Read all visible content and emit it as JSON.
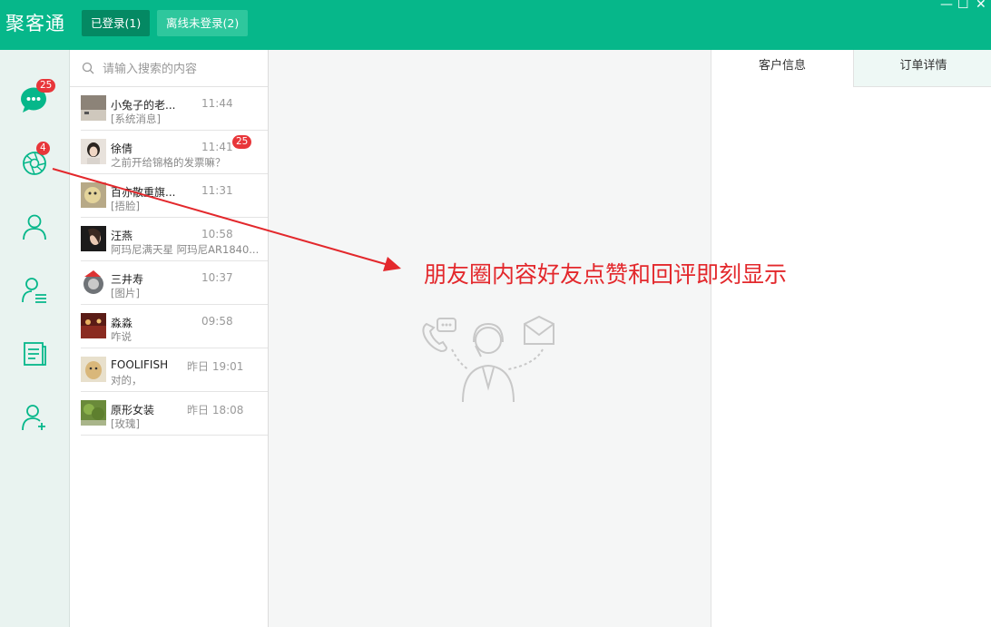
{
  "app": {
    "title": "聚客通",
    "tab_logged_in": "已登录(1)",
    "tab_offline": "离线未登录(2)",
    "window_controls": [
      "—",
      "☐",
      "✕"
    ]
  },
  "nav": {
    "chat_badge": "25",
    "moments_badge": "4"
  },
  "search": {
    "placeholder": "请输入搜索的内容"
  },
  "chats": [
    {
      "name": "小兔子的老...",
      "time": "11:44",
      "msg": "[系统消息]"
    },
    {
      "name": "徐倩",
      "time": "11:41",
      "msg": "之前开给锦格的发票嘛？",
      "badge": "25"
    },
    {
      "name": "百亦散重旗...",
      "time": "11:31",
      "msg": "[捂脸]"
    },
    {
      "name": "汪燕",
      "time": "10:58",
      "msg": "阿玛尼满天星 阿玛尼AR1840..."
    },
    {
      "name": "三井寿",
      "time": "10:37",
      "msg": "[图片]"
    },
    {
      "name": "淼淼",
      "time": "09:58",
      "msg": "咋说"
    },
    {
      "name": "FOOLIFISH",
      "time": "昨日 19:01",
      "msg": "对的，"
    },
    {
      "name": "原形女装",
      "time": "昨日 18:08",
      "msg": "[玫瑰]"
    }
  ],
  "right_tabs": {
    "customer": "客户信息",
    "order": "订单详情"
  },
  "annotation": "朋友圈内容好友点赞和回评即刻显示",
  "colors": {
    "brand": "#06b78a",
    "badge": "#e8363a",
    "annotation": "#e3282c"
  }
}
